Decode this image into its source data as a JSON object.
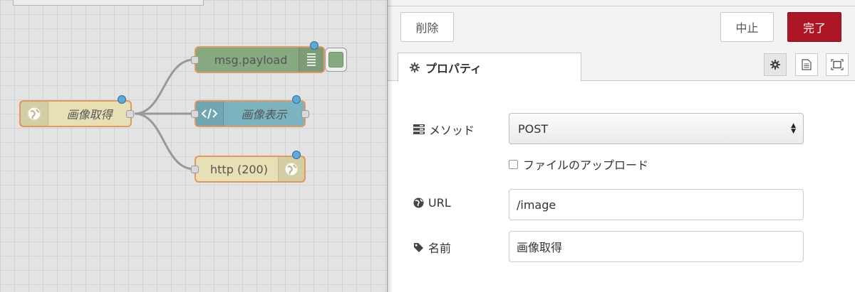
{
  "nodes": {
    "http_in": {
      "label": "画像取得",
      "icon": "globe-icon"
    },
    "debug": {
      "label": "msg.payload",
      "icon": "list-icon"
    },
    "template": {
      "label": "画像表示",
      "icon": "code-icon"
    },
    "http_response": {
      "label": "http (200)",
      "icon": "globe-icon"
    }
  },
  "toolbar": {
    "delete_label": "削除",
    "cancel_label": "中止",
    "done_label": "完了"
  },
  "tabs": {
    "properties_label": "プロパティ"
  },
  "form": {
    "method": {
      "label": "メソッド",
      "value": "POST"
    },
    "upload": {
      "label": "ファイルのアップロード",
      "checked": false
    },
    "url": {
      "label": "URL",
      "value": "/image"
    },
    "name": {
      "label": "名前",
      "value": "画像取得"
    }
  },
  "colors": {
    "http_node": "#e6e0b4",
    "debug_node": "#87a980",
    "template_node": "#7bb4c0",
    "node_border": "#e19a66",
    "done_button": "#ad1625",
    "port_dot": "#5fa8d8"
  }
}
